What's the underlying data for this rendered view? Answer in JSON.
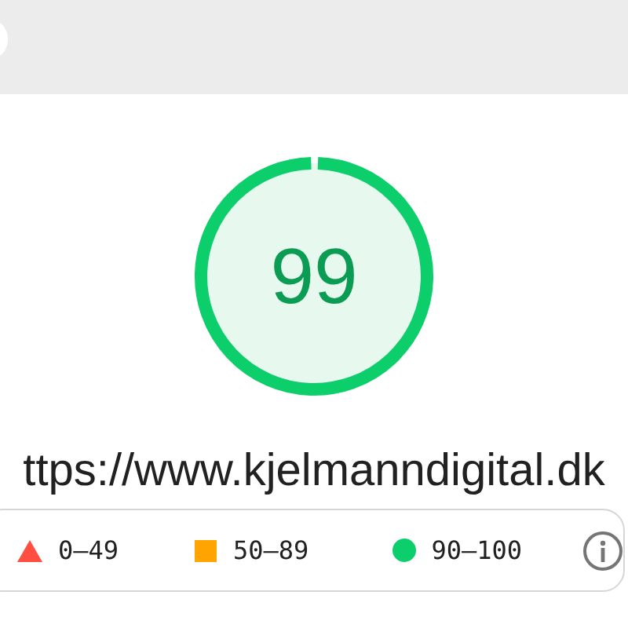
{
  "gauge": {
    "score": "99"
  },
  "url": "ttps://www.kjelmanndigital.dk",
  "legend": [
    {
      "kind": "triangle",
      "label": "0–49",
      "color": "#ff4e42"
    },
    {
      "kind": "square",
      "label": "50–89",
      "color": "#ffa400"
    },
    {
      "kind": "circle",
      "label": "90–100",
      "color": "#0cce6b"
    }
  ]
}
